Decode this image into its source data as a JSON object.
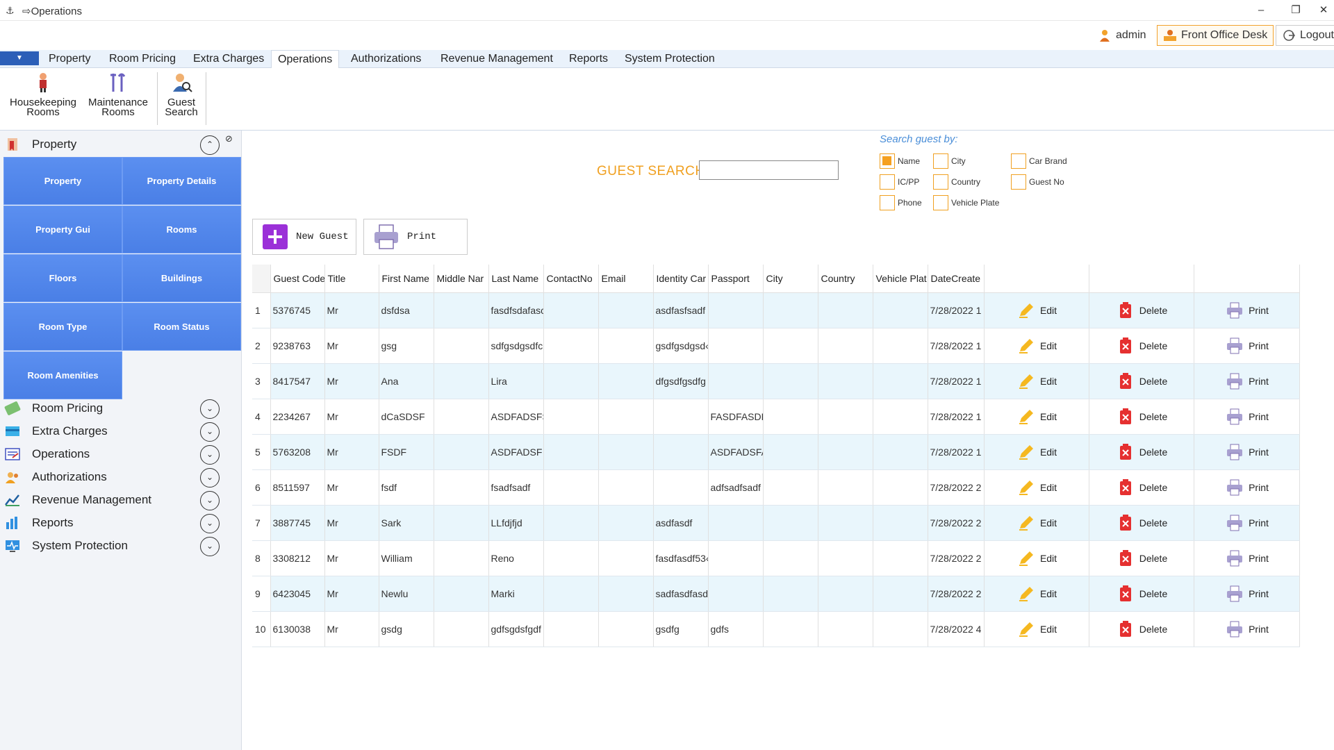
{
  "window": {
    "title": "⇨Operations",
    "minimize": "–",
    "restore": "❐",
    "close": "✕"
  },
  "userbar": {
    "user": "admin",
    "desk": "Front Office Desk",
    "logout": "Logout"
  },
  "menu": {
    "dropdown": "▼",
    "items": [
      "Property",
      "Room Pricing",
      "Extra Charges",
      "Operations",
      "Authorizations",
      "Revenue Management",
      "Reports",
      "System Protection"
    ],
    "active": "Operations"
  },
  "ribbon": {
    "buttons": [
      {
        "line1": "Housekeeping",
        "line2": "Rooms"
      },
      {
        "line1": "Maintenance",
        "line2": "Rooms"
      },
      {
        "line1": "Guest",
        "line2": "Search"
      }
    ]
  },
  "sidebar": {
    "property_header": "Property",
    "tiles": [
      "Property",
      "Property Details",
      "Property Gui",
      "Rooms",
      "Floors",
      "Buildings",
      "Room Type",
      "Room Status",
      "Room Amenities"
    ],
    "sections": [
      "Room Pricing",
      "Extra Charges",
      "Operations",
      "Authorizations",
      "Revenue Management",
      "Reports",
      "System Protection"
    ],
    "chev_up": "⌃",
    "chev_down": "⌄"
  },
  "search": {
    "title": "GUEST SEARCH",
    "value": "",
    "by_label": "Search guest by:",
    "options": [
      {
        "label": "Name",
        "checked": true
      },
      {
        "label": "IC/PP",
        "checked": false
      },
      {
        "label": "Phone",
        "checked": false
      },
      {
        "label": "City",
        "checked": false
      },
      {
        "label": "Country",
        "checked": false
      },
      {
        "label": "Vehicle Plate",
        "checked": false
      },
      {
        "label": "Car Brand",
        "checked": false
      },
      {
        "label": "Guest No",
        "checked": false
      }
    ]
  },
  "actions": {
    "new_guest": "New Guest",
    "print": "Print"
  },
  "table": {
    "headers": [
      "Guest Code",
      "Title",
      "First Name",
      "Middle Nar",
      "Last Name",
      "ContactNo",
      "Email",
      "Identity Car",
      "Passport",
      "City",
      "Country",
      "Vehicle Plat",
      "DateCreate"
    ],
    "edit_label": "Edit",
    "delete_label": "Delete",
    "print_label": "Print",
    "rows": [
      {
        "n": "1",
        "code": "5376745",
        "title": "Mr",
        "first": "dsfdsa",
        "middle": "",
        "last": "fasdfsdafasc",
        "contact": "",
        "email": "",
        "identity": "asdfasfsadf",
        "passport": "",
        "city": "",
        "country": "",
        "vehicle": "",
        "date": "7/28/2022 1"
      },
      {
        "n": "2",
        "code": "9238763",
        "title": "Mr",
        "first": "gsg",
        "middle": "",
        "last": "sdfgsdgsdfc",
        "contact": "",
        "email": "",
        "identity": "gsdfgsdgsd‹",
        "passport": "",
        "city": "",
        "country": "",
        "vehicle": "",
        "date": "7/28/2022 1"
      },
      {
        "n": "3",
        "code": "8417547",
        "title": "Mr",
        "first": "Ana",
        "middle": "",
        "last": "Lira",
        "contact": "",
        "email": "",
        "identity": "dfgsdfgsdfg",
        "passport": "",
        "city": "",
        "country": "",
        "vehicle": "",
        "date": "7/28/2022 1"
      },
      {
        "n": "4",
        "code": "2234267",
        "title": "Mr",
        "first": "dCaSDSF",
        "middle": "",
        "last": "ASDFADSFS",
        "contact": "",
        "email": "",
        "identity": "",
        "passport": "FASDFASDF",
        "city": "",
        "country": "",
        "vehicle": "",
        "date": "7/28/2022 1"
      },
      {
        "n": "5",
        "code": "5763208",
        "title": "Mr",
        "first": "FSDF",
        "middle": "",
        "last": "ASDFADSF",
        "contact": "",
        "email": "",
        "identity": "",
        "passport": "ASDFADSFA",
        "city": "",
        "country": "",
        "vehicle": "",
        "date": "7/28/2022 1"
      },
      {
        "n": "6",
        "code": "8511597",
        "title": "Mr",
        "first": "fsdf",
        "middle": "",
        "last": "fsadfsadf",
        "contact": "",
        "email": "",
        "identity": "",
        "passport": "adfsadfsadf",
        "city": "",
        "country": "",
        "vehicle": "",
        "date": "7/28/2022 2"
      },
      {
        "n": "7",
        "code": "3887745",
        "title": "Mr",
        "first": "Sark",
        "middle": "",
        "last": "LLfdjfjd",
        "contact": "",
        "email": "",
        "identity": "asdfasdf",
        "passport": "",
        "city": "",
        "country": "",
        "vehicle": "",
        "date": "7/28/2022 2"
      },
      {
        "n": "8",
        "code": "3308212",
        "title": "Mr",
        "first": "William",
        "middle": "",
        "last": "Reno",
        "contact": "",
        "email": "",
        "identity": "fasdfasdf53‹",
        "passport": "",
        "city": "",
        "country": "",
        "vehicle": "",
        "date": "7/28/2022 2"
      },
      {
        "n": "9",
        "code": "6423045",
        "title": "Mr",
        "first": "Newlu",
        "middle": "",
        "last": "Marki",
        "contact": "",
        "email": "",
        "identity": "sadfasdfasd",
        "passport": "",
        "city": "",
        "country": "",
        "vehicle": "",
        "date": "7/28/2022 2"
      },
      {
        "n": "10",
        "code": "6130038",
        "title": "Mr",
        "first": "gsdg",
        "middle": "",
        "last": "gdfsgdsfgdf",
        "contact": "",
        "email": "",
        "identity": "gsdfg",
        "passport": "gdfs",
        "city": "",
        "country": "",
        "vehicle": "",
        "date": "7/28/2022 4"
      }
    ]
  },
  "colors": {
    "accent": "#f0a020",
    "tile": "#4a7fe6",
    "row_alt": "#e9f6fc",
    "link_blue": "#4a8ed8"
  }
}
